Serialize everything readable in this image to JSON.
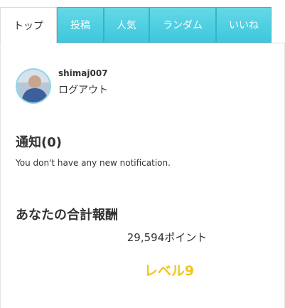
{
  "tabs": [
    {
      "label": "トップ",
      "active": true
    },
    {
      "label": "投稿",
      "active": false
    },
    {
      "label": "人気",
      "active": false
    },
    {
      "label": "ランダム",
      "active": false
    },
    {
      "label": "いいね",
      "active": false
    }
  ],
  "profile": {
    "username": "shimaj007",
    "logout_label": "ログアウト"
  },
  "notifications": {
    "heading": "通知(0)",
    "message": "You don't have any new notification."
  },
  "rewards": {
    "heading": "あなたの合計報酬",
    "points": "29,594ポイント",
    "level": "レベル9"
  },
  "colors": {
    "accent": "#3fc7dc",
    "level": "#f5c518"
  }
}
